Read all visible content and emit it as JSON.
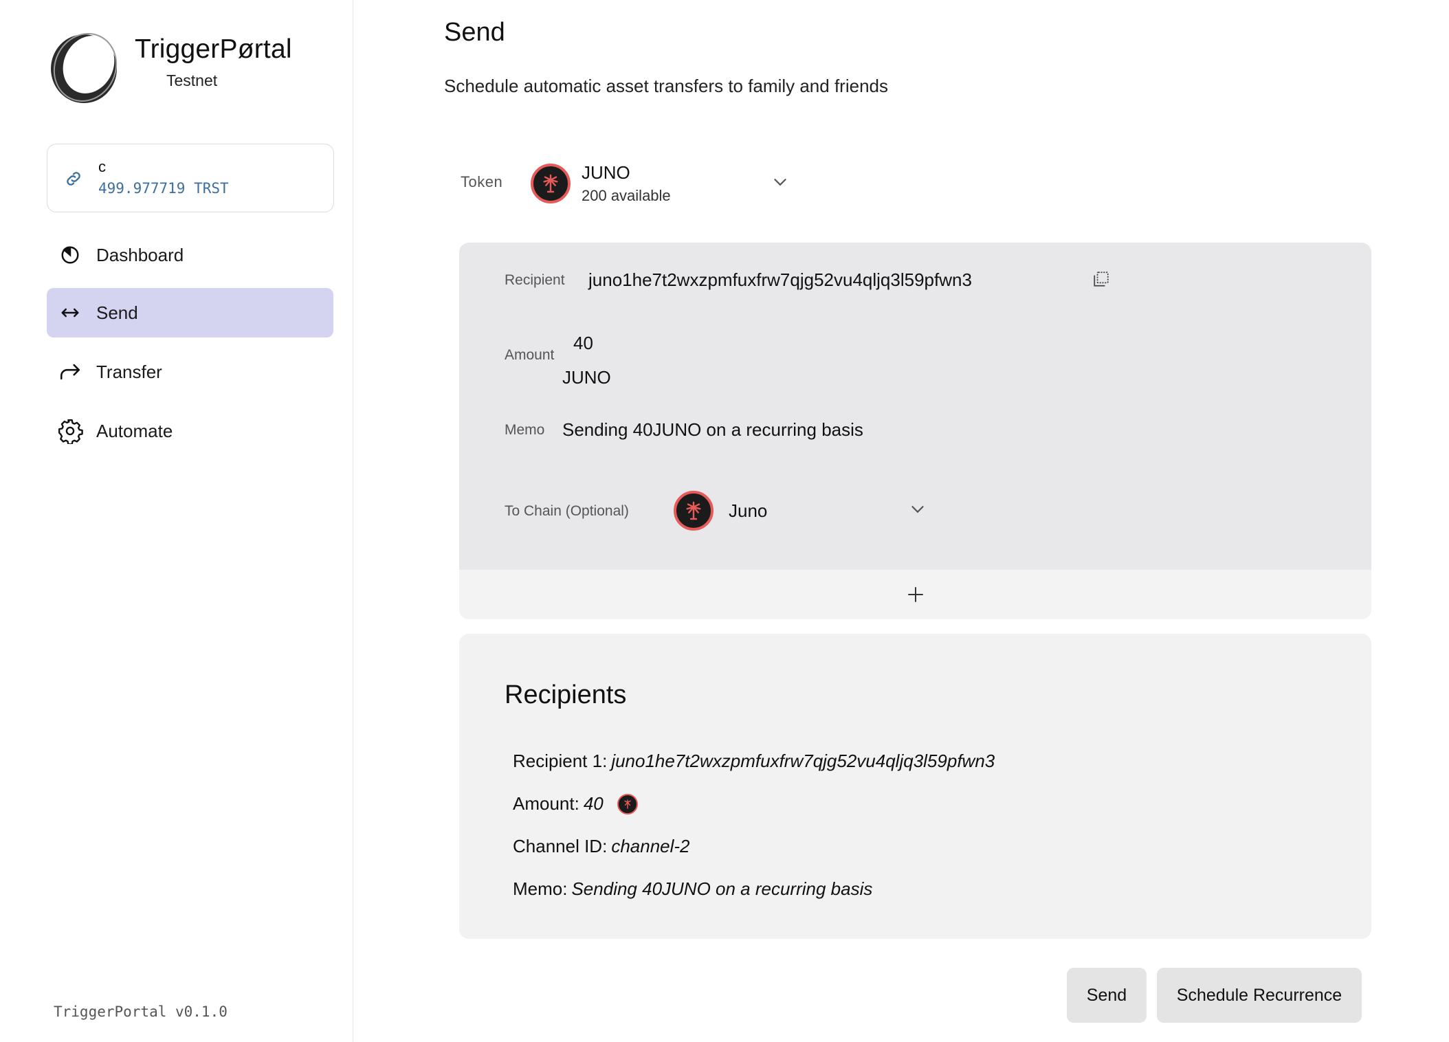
{
  "brand": {
    "name": "TriggerPørtal",
    "network": "Testnet"
  },
  "wallet": {
    "name": "c",
    "balance": "499.977719 TRST"
  },
  "nav": [
    {
      "label": "Dashboard",
      "icon": "dashboard-icon",
      "active": false
    },
    {
      "label": "Send",
      "icon": "send-arrows-icon",
      "active": true
    },
    {
      "label": "Transfer",
      "icon": "transfer-arrow-icon",
      "active": false
    },
    {
      "label": "Automate",
      "icon": "gear-icon",
      "active": false
    }
  ],
  "version": "TriggerPortal v0.1.0",
  "page": {
    "title": "Send",
    "subtitle": "Schedule automatic asset transfers to family and friends"
  },
  "token": {
    "label": "Token",
    "name": "JUNO",
    "available": "200 available"
  },
  "form": {
    "recipient_label": "Recipient",
    "recipient_value": "juno1he7t2wxzpmfuxfrw7qjg52vu4qljq3l59pfwn3",
    "amount_label": "Amount",
    "amount_value": "40",
    "amount_denom": "JUNO",
    "memo_label": "Memo",
    "memo_value": "Sending 40JUNO on a recurring basis",
    "chain_label": "To Chain (Optional)",
    "chain_value": "Juno"
  },
  "summary": {
    "title": "Recipients",
    "recipient_key": "Recipient 1:",
    "recipient_val": "juno1he7t2wxzpmfuxfrw7qjg52vu4qljq3l59pfwn3",
    "amount_key": "Amount:",
    "amount_val": "40",
    "channel_key": "Channel ID:",
    "channel_val": "channel-2",
    "memo_key": "Memo:",
    "memo_val": "Sending 40JUNO on a recurring basis"
  },
  "actions": {
    "send": "Send",
    "schedule": "Schedule Recurrence"
  },
  "colors": {
    "active_nav": "#d4d3f0",
    "card": "#e8e8ea",
    "accent_coin": "#e75a5a",
    "balance": "#3c6e9e"
  }
}
